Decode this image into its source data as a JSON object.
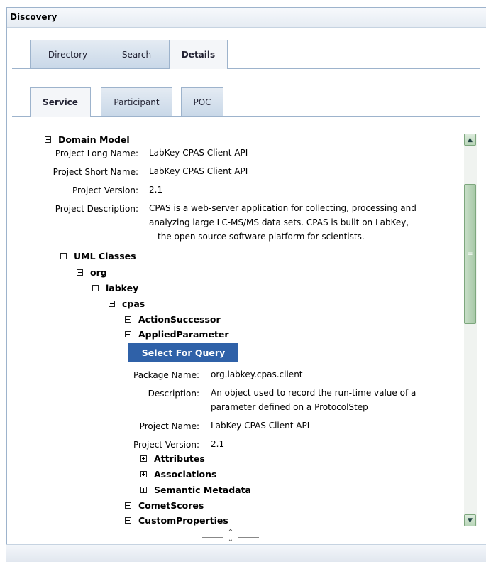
{
  "panel": {
    "title": "Discovery"
  },
  "tabs_top": [
    "Directory",
    "Search",
    "Details"
  ],
  "tabs_sub": [
    "Service",
    "Participant",
    "POC"
  ],
  "domain_model": {
    "heading": "Domain Model",
    "fields": [
      {
        "label": "Project Long Name:",
        "value": "LabKey CPAS Client API"
      },
      {
        "label": "Project Short Name:",
        "value": "LabKey CPAS Client API"
      },
      {
        "label": "Project Version:",
        "value": "2.1"
      },
      {
        "label": "Project Description:",
        "value_lines": [
          "CPAS is a web-server application for collecting, processing and",
          "analyzing large LC-MS/MS data sets. CPAS is built on LabKey,",
          "the open source software platform for scientists."
        ]
      }
    ]
  },
  "tree": {
    "uml_classes": "UML Classes",
    "org": "org",
    "labkey": "labkey",
    "cpas": "cpas",
    "action_successor": "ActionSuccessor",
    "applied_parameter": "AppliedParameter",
    "comet_scores": "CometScores",
    "custom_properties": "CustomProperties"
  },
  "applied_parameter": {
    "button": "Select For Query",
    "fields": [
      {
        "label": "Package Name:",
        "value": "org.labkey.cpas.client"
      },
      {
        "label": "Description:",
        "value_lines": [
          "An object used to record the run-time value of a",
          "parameter defined on a ProtocolStep"
        ]
      },
      {
        "label": "Project Name:",
        "value": "LabKey CPAS Client API"
      },
      {
        "label": "Project Version:",
        "value": "2.1"
      }
    ],
    "children": [
      "Attributes",
      "Associations",
      "Semantic Metadata"
    ]
  },
  "scrollbar": {
    "up": "scroll-up",
    "down": "scroll-down"
  }
}
